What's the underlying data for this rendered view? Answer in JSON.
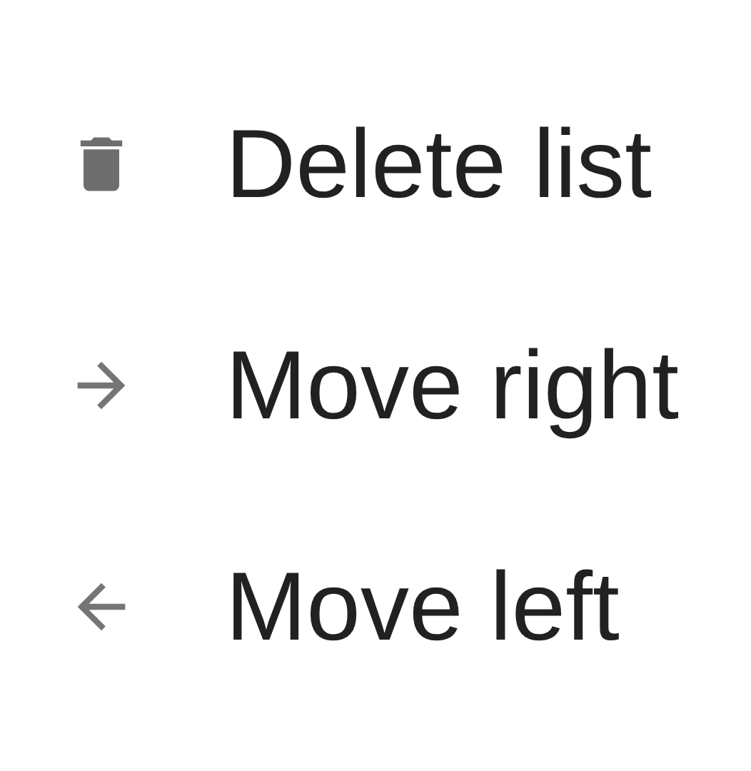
{
  "menu": {
    "items": [
      {
        "kind": "trash",
        "label": "Delete list"
      },
      {
        "kind": "arrow-right",
        "label": "Move right"
      },
      {
        "kind": "arrow-left",
        "label": "Move left"
      }
    ]
  }
}
